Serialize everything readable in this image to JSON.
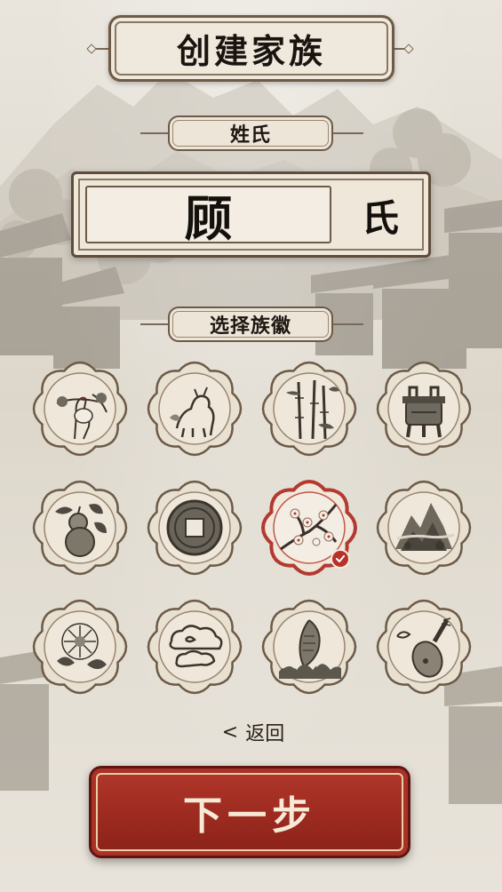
{
  "header": {
    "title": "创建家族"
  },
  "surname": {
    "label": "姓氏",
    "value": "顾",
    "suffix": "氏"
  },
  "emblems": {
    "label": "选择族徽",
    "items": [
      {
        "icon": "crane-pine-icon"
      },
      {
        "icon": "qilin-icon"
      },
      {
        "icon": "bamboo-icon"
      },
      {
        "icon": "bronze-ding-icon"
      },
      {
        "icon": "gourd-icon"
      },
      {
        "icon": "ancient-coin-icon"
      },
      {
        "icon": "plum-blossom-icon",
        "selected": true
      },
      {
        "icon": "mountain-landscape-icon"
      },
      {
        "icon": "chrysanthemum-icon"
      },
      {
        "icon": "auspicious-cloud-icon"
      },
      {
        "icon": "carp-wave-icon"
      },
      {
        "icon": "pipa-lute-icon"
      }
    ]
  },
  "nav": {
    "back_arrow": "<",
    "back_label": "返回",
    "next_label": "下一步"
  },
  "colors": {
    "accent_red": "#a8302a",
    "ink": "#1a1410",
    "paper": "#ece5d8",
    "frame_brown": "#6d5a47"
  }
}
